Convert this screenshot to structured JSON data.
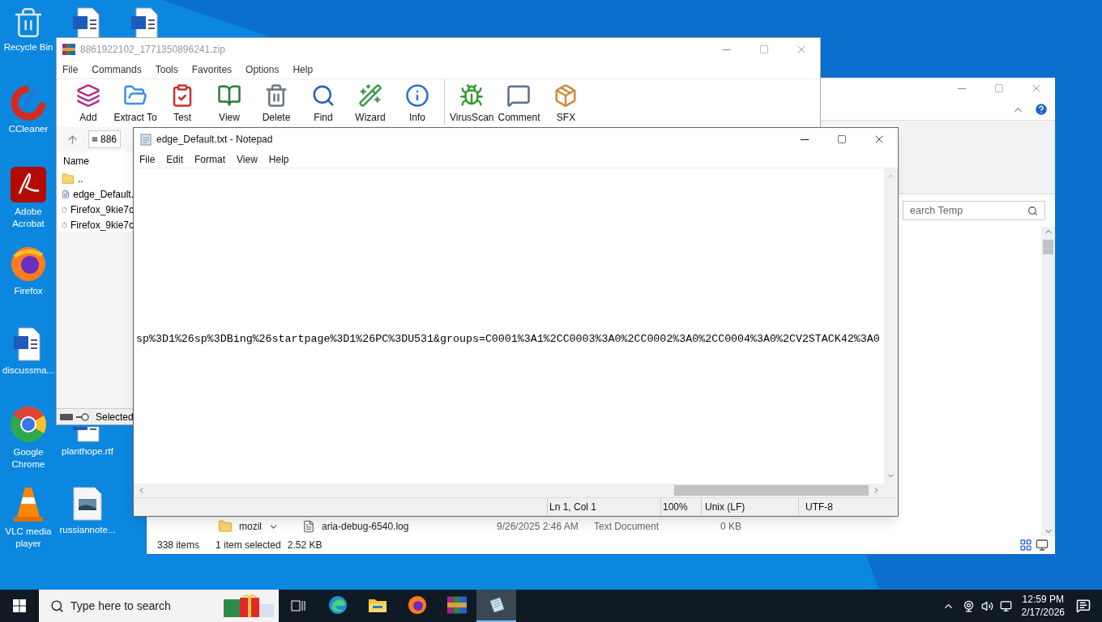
{
  "desktop_icons": [
    {
      "label": "Recycle Bin"
    },
    {
      "label": "CCleaner"
    },
    {
      "label": "Adobe Acrobat"
    },
    {
      "label": "Firefox"
    },
    {
      "label": "discussma..."
    },
    {
      "label": "Google Chrome"
    },
    {
      "label": "VLC media player"
    },
    {
      "label": "planthope.rtf"
    },
    {
      "label": "russiannote..."
    }
  ],
  "explorer": {
    "search_text": "earch Temp",
    "nav_item": "mozil",
    "file": {
      "name": "aria-debug-6540.log",
      "date": "9/26/2025 2:46 AM",
      "type": "Text Document",
      "size": "0 KB"
    },
    "status_bar": [
      "338 items",
      "1 item selected",
      "2.52 KB"
    ]
  },
  "winrar": {
    "title": "8861922102_1771350896241.zip",
    "menu": [
      "File",
      "Commands",
      "Tools",
      "Favorites",
      "Options",
      "Help"
    ],
    "toolbar": [
      [
        "Add",
        "Extract To",
        "Test",
        "View",
        "Delete",
        "Find",
        "Wizard",
        "Info"
      ],
      [
        "VirusScan",
        "Comment",
        "SFX"
      ]
    ],
    "path": "886",
    "column": "Name",
    "files": [
      {
        "name": "..",
        "kind": "folder"
      },
      {
        "name": "edge_Default.",
        "kind": "text"
      },
      {
        "name": "Firefox_9kie7c",
        "kind": "file"
      },
      {
        "name": "Firefox_9kie7c",
        "kind": "file"
      }
    ],
    "status": "Selected"
  },
  "notepad": {
    "title": "edge_Default.txt - Notepad",
    "menu": [
      "File",
      "Edit",
      "Format",
      "View",
      "Help"
    ],
    "text": "sp%3D1%26sp%3DBing%26startpage%3D1%26PC%3DU531&groups=C0001%3A1%2CC0003%3A0%2CC0002%3A0%2CC0004%3A0%2CV2STACK42%3A0",
    "status_bar": [
      "Ln 1, Col 1",
      "100%",
      "Unix (LF)",
      "UTF-8"
    ]
  },
  "taskbar": {
    "search_placeholder": "Type here to search",
    "apps": [
      {
        "selected": false
      },
      {
        "selected": false
      },
      {
        "selected": false
      },
      {
        "selected": false
      },
      {
        "selected": true
      }
    ],
    "time": "12:59 PM",
    "date": "2/17/2026"
  }
}
